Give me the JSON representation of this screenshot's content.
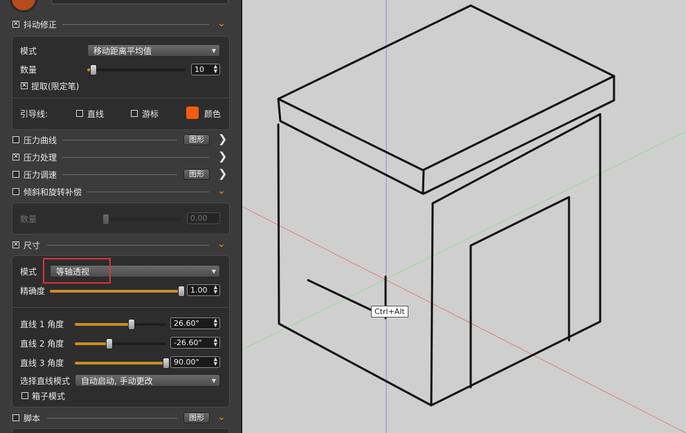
{
  "stabilizer": {
    "title": "抖动修正",
    "checked": true,
    "mode_label": "模式",
    "mode_value": "移动距离平均值",
    "amount_label": "数量",
    "amount_value": "10",
    "amount_fraction": 0.06,
    "extract_label": "提取(限定笔)",
    "extract_checked": true,
    "guide_label": "引导线:",
    "line_label": "直线",
    "cursor_label": "游标",
    "color_label": "颜色",
    "color": "#f55b12"
  },
  "pressure_curve": {
    "title": "压力曲线",
    "checked": false,
    "button": "图形"
  },
  "pressure_process": {
    "title": "压力处理",
    "checked": true
  },
  "pressure_speed": {
    "title": "压力调速",
    "checked": false,
    "button": "图形"
  },
  "tilt": {
    "title": "倾斜和旋转补偿",
    "checked": false,
    "amount_label": "数量",
    "amount_value": "0.00",
    "amount_fraction": 0.0
  },
  "size": {
    "title": "尺寸",
    "checked": true,
    "mode_label": "模式",
    "mode_value": "等轴透视",
    "precision_label": "精确度",
    "precision_value": "1.00",
    "precision_fraction": 1.0,
    "lines": [
      {
        "label": "直线 1 角度",
        "value": "26.60°",
        "fraction": 0.62
      },
      {
        "label": "直线 2 角度",
        "value": "-26.60°",
        "fraction": 0.38
      },
      {
        "label": "直线 3 角度",
        "value": "90.00°",
        "fraction": 1.0
      }
    ],
    "select_label": "选择直线模式",
    "select_value": "自动启动, 手动更改",
    "box_mode_label": "箱子模式",
    "box_mode_checked": false
  },
  "script": {
    "title": "脚本",
    "checked": false,
    "button": "图形"
  },
  "tooltip": "Ctrl+Alt",
  "colors": {
    "accent": "#c88d26",
    "highlight": "#e0303a",
    "canvas": "#cfcfcf"
  }
}
